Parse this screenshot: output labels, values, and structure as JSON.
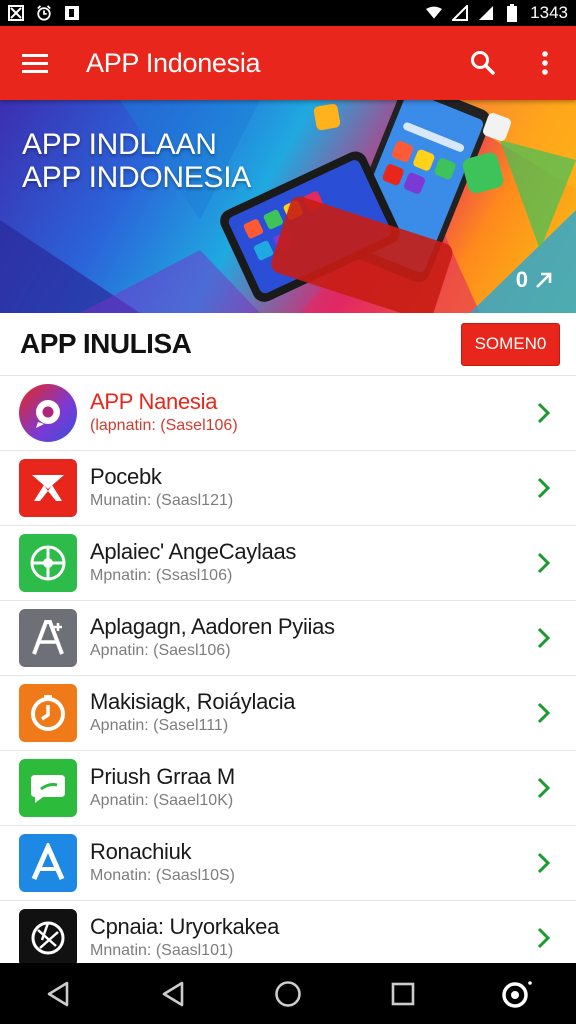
{
  "status_bar": {
    "time": "1343",
    "left_icons": [
      "image-icon",
      "clock-icon",
      "photo-icon"
    ],
    "right_icons": [
      "wifi-icon",
      "signal-icon",
      "signal-icon-2",
      "battery-icon"
    ]
  },
  "app_bar": {
    "title": "APP Indonesia",
    "color": "#e8261b",
    "icons": [
      "menu-icon",
      "search-icon",
      "more-vert-icon"
    ]
  },
  "banner": {
    "line1": "APP INDLAAN",
    "line2": "APP INDONESIA",
    "badge": "0"
  },
  "section": {
    "title": "APP INULISA",
    "button_label": "SOMEN0"
  },
  "apps": [
    {
      "name": "APP Nanesia",
      "sub": "(lapnatin: (Sasel106)",
      "icon": "chat-bubble-icon",
      "color": "#7b3ad6"
    },
    {
      "name": "Pocebk",
      "sub": "Munatin: (Saasl121)",
      "icon": "envelope-icon",
      "color": "#e8261b"
    },
    {
      "name": "Aplaiec' AngeCaylaas",
      "sub": "Mpnatin: (Ssasl106)",
      "icon": "compass-icon",
      "color": "#2dbb4a"
    },
    {
      "name": "Aplagagn, Aadoren Pyiias",
      "sub": "Apnatin: (Saesl106)",
      "icon": "letter-a-icon",
      "color": "#6d7077"
    },
    {
      "name": "Makisiagk, Roiáylacia",
      "sub": "Apnatin: (Sasel111)",
      "icon": "timer-icon",
      "color": "#f07a1a"
    },
    {
      "name": "Priush Grraa M",
      "sub": "Apnatin: (Saael10K)",
      "icon": "message-icon",
      "color": "#2dbb3c"
    },
    {
      "name": "Ronachiuk",
      "sub": "Monatin: (Saasl10S)",
      "icon": "app-store-icon",
      "color": "#1e88e5"
    },
    {
      "name": "Cpnaia: Uryorkakea",
      "sub": "Mnnatin: (Saasl101)",
      "icon": "aperture-icon",
      "color": "#111111"
    }
  ],
  "nav_bar": {
    "icons": [
      "back-icon",
      "back-icon-2",
      "home-icon",
      "recents-icon",
      "assistant-icon"
    ]
  }
}
